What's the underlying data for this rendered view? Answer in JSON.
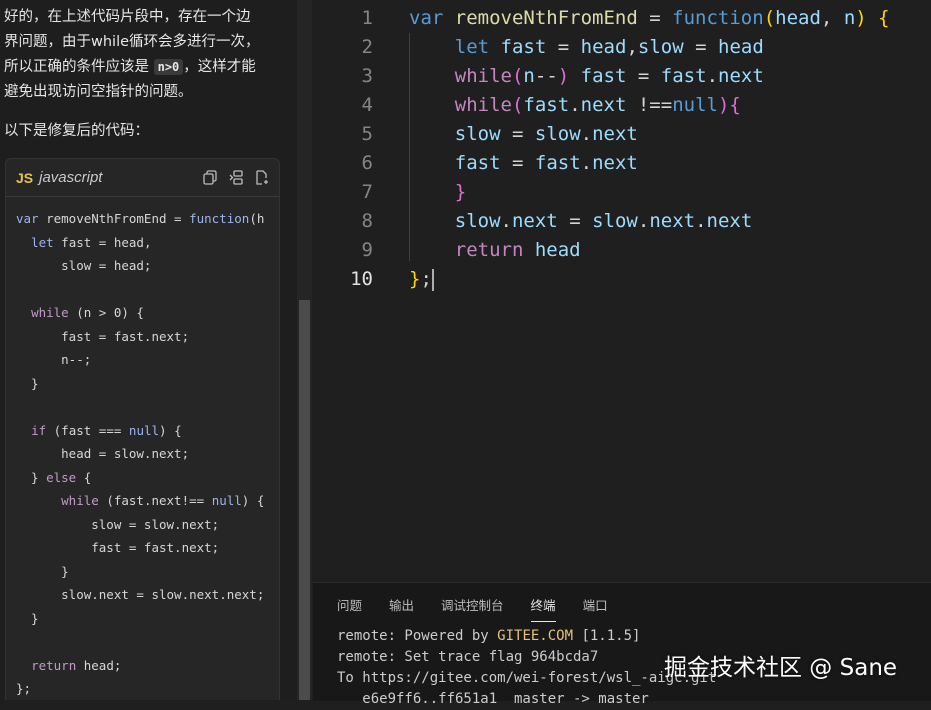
{
  "chat": {
    "paragraph_lines": [
      "好的，在上述代码片段中，存在一个边",
      "界问题，由于while循环会多进行一次，",
      "所以正确的条件应该是"
    ],
    "inline_code": "n>0",
    "paragraph_tail": "，这样才能",
    "paragraph_last": "避免出现访问空指针的问题。",
    "subheading": "以下是修复后的代码：",
    "code_block": {
      "badge": "JS",
      "language": "javascript",
      "icons": [
        "copy-icon",
        "insert-icon",
        "new-file-icon"
      ],
      "lines": [
        "var removeNthFromEnd = function(h",
        "  let fast = head,",
        "      slow = head;",
        "",
        "  while (n > 0) {",
        "      fast = fast.next;",
        "      n--;",
        "  }",
        "",
        "  if (fast === null) {",
        "      head = slow.next;",
        "  } else {",
        "      while (fast.next!== null) {",
        "          slow = slow.next;",
        "          fast = fast.next;",
        "      }",
        "      slow.next = slow.next.next;",
        "  }",
        "",
        "  return head;",
        "};"
      ]
    }
  },
  "editor": {
    "line_numbers": [
      "1",
      "2",
      "3",
      "4",
      "5",
      "6",
      "7",
      "8",
      "9",
      "10"
    ],
    "active_line": "10",
    "lines": [
      "var removeNthFromEnd = function(head, n) {",
      "    let fast = head,slow = head",
      "    while(n--) fast = fast.next",
      "    while(fast.next !==null){",
      "    slow = slow.next",
      "    fast = fast.next",
      "    }",
      "    slow.next = slow.next.next",
      "    return head",
      "};"
    ]
  },
  "panel": {
    "tabs": [
      "问题",
      "输出",
      "调试控制台",
      "终端",
      "端口"
    ],
    "active_tab": "终端",
    "terminal_lines": [
      "remote: Powered by GITEE.COM [1.1.5]",
      "remote: Set trace flag 964bcda7",
      "To https://gitee.com/wei-forest/wsl_-aigc.git",
      "   e6e9ff6..ff651a1  master -> master"
    ]
  },
  "watermark": "掘金技术社区 @ Sane",
  "colors": {
    "keyword": "#569cd6",
    "function": "#dcdcaa",
    "variable": "#9cdcfe",
    "control": "#c586c0",
    "bracket": "#ffd700"
  }
}
